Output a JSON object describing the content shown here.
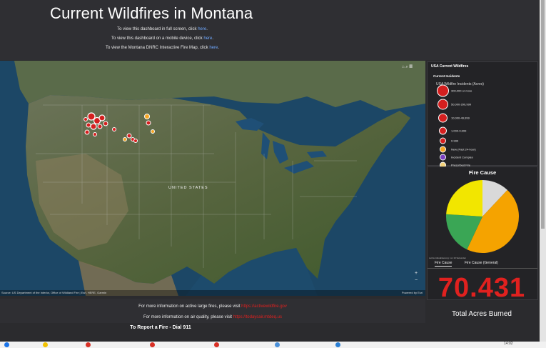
{
  "header": {
    "title": "Current Wildfires in Montana",
    "line1_text": "To view this dashboard in full screen, click ",
    "line1_link": "here",
    "line2_text": "To view this dashboard on a mobile device, click ",
    "line2_link": "here",
    "line3_text": "To view the Montana DNRC Interactive Fire Map, click ",
    "line3_link": "here"
  },
  "map": {
    "country_label": "UNITED STATES",
    "attribution_left": "Source: US Department of the Interior, Office of Wildland Fire | Esri, HERE, Garmin",
    "attribution_right": "Powered by Esri",
    "tool_icons": [
      "home-icon",
      "search-icon",
      "grid-icon"
    ],
    "zoom_in": "+",
    "zoom_out": "−"
  },
  "legend": {
    "title": "USA Current Wildfires",
    "subtitle": "Current Incidents",
    "unit_label": "USA Wildfire Incidents (Acres)",
    "items": [
      {
        "label": "300,000 or more",
        "color": "#d41f1f"
      },
      {
        "label": "50,000-299,999",
        "color": "#d41f1f"
      },
      {
        "label": "10,000-49,999",
        "color": "#d41f1f"
      },
      {
        "label": "1,000-9,999",
        "color": "#d41f1f"
      },
      {
        "label": "0-999",
        "color": "#d41f1f"
      },
      {
        "label": "New (Past 24-hour)",
        "color": "#f5a623"
      },
      {
        "label": "Incident Complex",
        "color": "#7a3fc2"
      },
      {
        "label": "Prescribed Fire",
        "color": "#f3d27a"
      }
    ]
  },
  "fire_cause": {
    "title": "Fire Cause",
    "update_note": "Letzte Aktualisierung: vor 19 Sekunden",
    "tabs": [
      "Fire Cause",
      "Fire Cause (General)"
    ],
    "active_tab": 0
  },
  "chart_data": {
    "type": "pie",
    "title": "Fire Cause",
    "slices": [
      {
        "color": "#d9d9d9",
        "value": 12
      },
      {
        "color": "#f5a300",
        "value": 45
      },
      {
        "color": "#3aa655",
        "value": 19
      },
      {
        "color": "#f2e600",
        "value": 24
      }
    ]
  },
  "stat": {
    "value": "70.431",
    "label": "Total Acres Burned",
    "color": "#e0211f"
  },
  "info": {
    "line1_text": "For more information on active large fires, please visit ",
    "line1_link": "https://activewildfire.gov",
    "line2_text": "For more information on air quality, please visit ",
    "line2_link": "https://todaysair.mtdeq.us"
  },
  "report": {
    "text": "To Report a Fire - Dial 911"
  },
  "taskbar": {
    "time": "14:02"
  }
}
